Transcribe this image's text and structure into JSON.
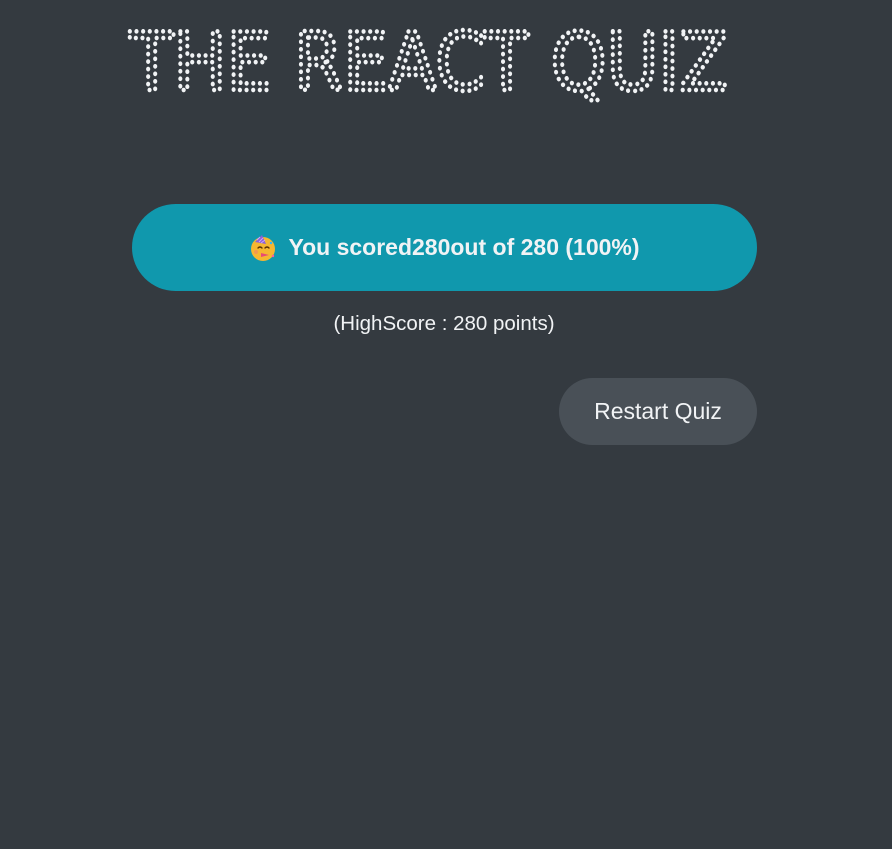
{
  "header": {
    "title": "THE REACT QUIZ"
  },
  "result": {
    "emoji_icon": "partying-face-icon",
    "text_prefix": "You scored ",
    "score": "280",
    "text_suffix": "out of 280 (100%)"
  },
  "highscore": {
    "text": "(HighScore : 280 points)"
  },
  "controls": {
    "restart_label": "Restart Quiz"
  },
  "colors": {
    "background": "#343a40",
    "accent": "#1098ad",
    "button": "#495057",
    "text": "#f1f3f5"
  }
}
